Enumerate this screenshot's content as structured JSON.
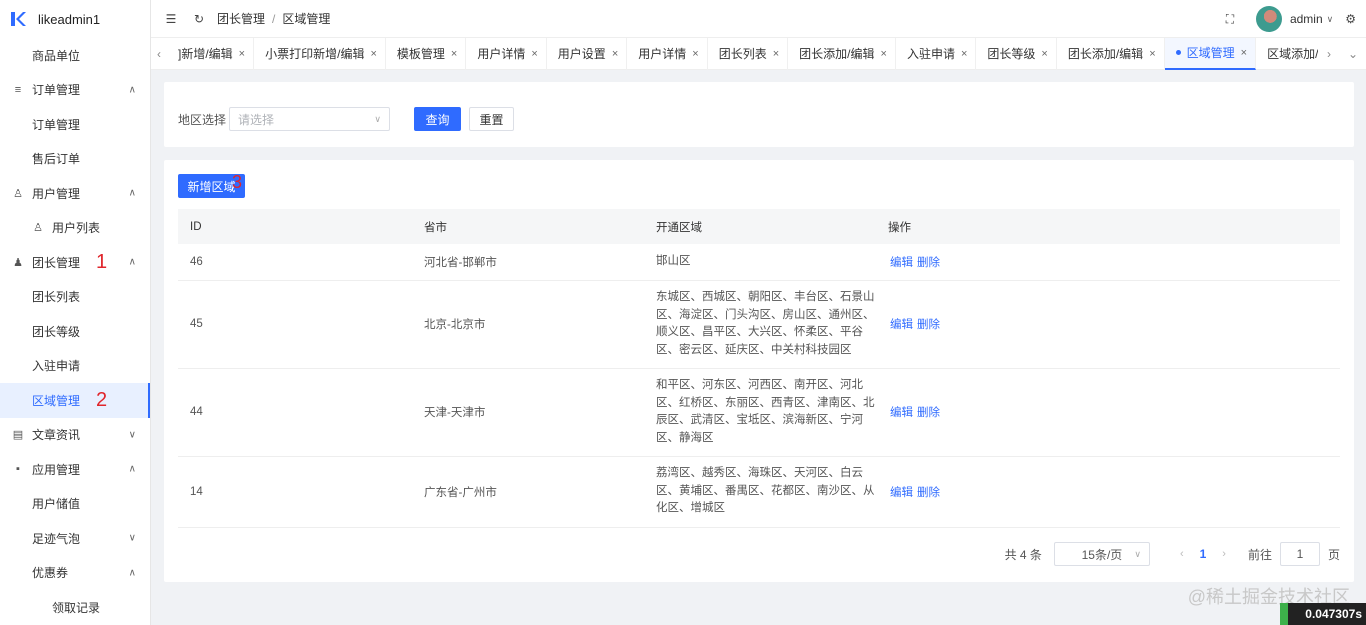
{
  "brand": {
    "name": "likeadmin1",
    "color": "#2f6bff"
  },
  "sidebar": {
    "items": [
      {
        "label": "商品单位",
        "level": "child"
      },
      {
        "label": "订单管理",
        "level": "parent",
        "icon": "list-icon",
        "chevron": "up"
      },
      {
        "label": "订单管理",
        "level": "child"
      },
      {
        "label": "售后订单",
        "level": "child"
      },
      {
        "label": "用户管理",
        "level": "parent",
        "icon": "user-outline-icon",
        "chevron": "up"
      },
      {
        "label": "用户列表",
        "level": "child",
        "icon": "users-icon"
      },
      {
        "label": "团长管理",
        "level": "parent",
        "icon": "user-filled-icon",
        "chevron": "up",
        "annotation": "1"
      },
      {
        "label": "团长列表",
        "level": "child"
      },
      {
        "label": "团长等级",
        "level": "child"
      },
      {
        "label": "入驻申请",
        "level": "child"
      },
      {
        "label": "区域管理",
        "level": "child",
        "active": true,
        "annotation": "2"
      },
      {
        "label": "文章资讯",
        "level": "parent",
        "icon": "article-icon",
        "chevron": "down"
      },
      {
        "label": "应用管理",
        "level": "parent",
        "icon": "apps-icon",
        "chevron": "up"
      },
      {
        "label": "用户储值",
        "level": "child"
      },
      {
        "label": "足迹气泡",
        "level": "child",
        "chevron": "down"
      },
      {
        "label": "优惠券",
        "level": "child",
        "chevron": "up"
      },
      {
        "label": "领取记录",
        "level": "grandchild"
      }
    ]
  },
  "header": {
    "breadcrumb": [
      "团长管理",
      "区域管理"
    ],
    "user": "admin"
  },
  "tabs": [
    {
      "label": "]新增/编辑"
    },
    {
      "label": "小票打印新增/编辑"
    },
    {
      "label": "模板管理"
    },
    {
      "label": "用户详情"
    },
    {
      "label": "用户设置"
    },
    {
      "label": "用户详情"
    },
    {
      "label": "团长列表"
    },
    {
      "label": "团长添加/编辑"
    },
    {
      "label": "入驻申请"
    },
    {
      "label": "团长等级"
    },
    {
      "label": "团长添加/编辑"
    },
    {
      "label": "区域管理",
      "active": true
    },
    {
      "label": "区域添加/编辑"
    }
  ],
  "search": {
    "label": "地区选择",
    "placeholder": "请选择",
    "query_button": "查询",
    "reset_button": "重置"
  },
  "table": {
    "add_button": "新增区域",
    "add_annotation": "3",
    "columns": [
      "ID",
      "省市",
      "开通区域",
      "操作"
    ],
    "rows": [
      {
        "id": "46",
        "city": "河北省-邯郸市",
        "regions": "邯山区",
        "edit": "编辑",
        "delete": "删除"
      },
      {
        "id": "45",
        "city": "北京-北京市",
        "regions": "东城区、西城区、朝阳区、丰台区、石景山区、海淀区、门头沟区、房山区、通州区、顺义区、昌平区、大兴区、怀柔区、平谷区、密云区、延庆区、中关村科技园区",
        "edit": "编辑",
        "delete": "删除"
      },
      {
        "id": "44",
        "city": "天津-天津市",
        "regions": "和平区、河东区、河西区、南开区、河北区、红桥区、东丽区、西青区、津南区、北辰区、武清区、宝坻区、滨海新区、宁河区、静海区",
        "edit": "编辑",
        "delete": "删除"
      },
      {
        "id": "14",
        "city": "广东省-广州市",
        "regions": "荔湾区、越秀区、海珠区、天河区、白云区、黄埔区、番禺区、花都区、南沙区、从化区、增城区",
        "edit": "编辑",
        "delete": "删除"
      }
    ]
  },
  "pagination": {
    "total": "共 4 条",
    "page_size": "15条/页",
    "current": "1",
    "goto_label": "前往",
    "goto_value": "1",
    "page_suffix": "页"
  },
  "watermark": "@稀土掘金技术社区",
  "timer": "0.047307s"
}
